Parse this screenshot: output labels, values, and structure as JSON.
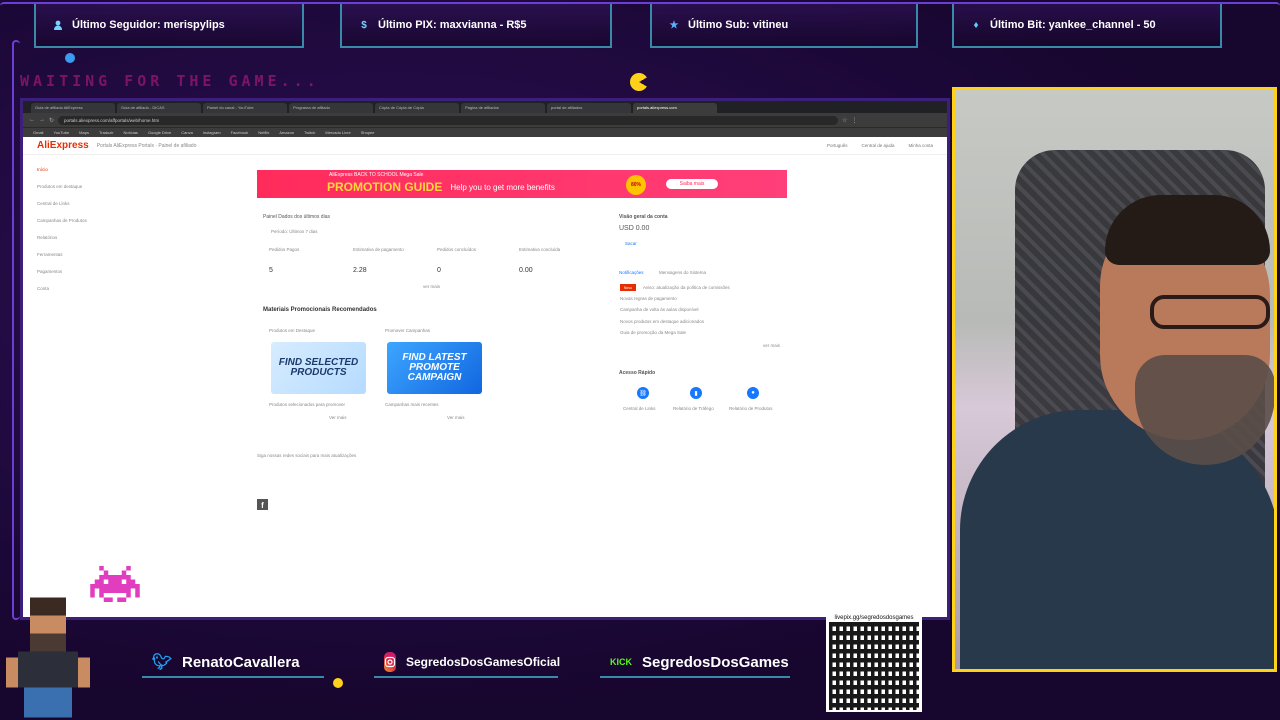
{
  "overlay": {
    "tickers": [
      {
        "icon": "user-icon",
        "text": "Último Seguidor: merispylips"
      },
      {
        "icon": "dollar-icon",
        "text": "Último PIX: maxvianna - R$5"
      },
      {
        "icon": "star-icon",
        "text": "Último Sub: vitineu"
      },
      {
        "icon": "diamond-icon",
        "text": "Último Bit: yankee_channel - 50"
      }
    ],
    "waiting_text": "WAITING FOR THE GAME...",
    "socials": [
      {
        "icon": "twitter-icon",
        "text": "RenatoCavallera",
        "color": "#1da1f2"
      },
      {
        "icon": "instagram-icon",
        "text": "SegredosDosGamesOficial",
        "color": "#e1306c"
      },
      {
        "icon": "kick-icon",
        "text": "SegredosDosGames",
        "color": "#53fc18",
        "icon_text": "KICK"
      }
    ],
    "qr_url": "livepix.gg/segredosdosgames",
    "accent": "#6b3fd6",
    "ticker_border": "#3a89a8",
    "webcam_border": "#ffd21a"
  },
  "browser": {
    "tabs": [
      "Guia de afiliado AliExpress",
      "Guia de afiliado - DICAS",
      "Painel do canal - YouTube",
      "Programa de afiliado",
      "Cópia de Cópia de Cópia",
      "Página de afiliados",
      "portal de afiliados",
      "portals.aliexpress.com"
    ],
    "url": "portals.aliexpress.com/affportals/web/home.htm",
    "bookmarks": [
      "Gmail",
      "YouTube",
      "Maps",
      "Traduzir",
      "Notícias",
      "Google Drive",
      "Canva",
      "Instagram",
      "Facebook",
      "Netflix",
      "Amazon",
      "Twitch",
      "Mercado Livre",
      "Shopee"
    ],
    "page": {
      "logo": "AliExpress",
      "logo_sub": "Portals  AliExpress Portals · Painel de afiliado",
      "header_right": [
        "Português",
        "Central de ajuda",
        "Minha conta"
      ],
      "sidebar": [
        "Início",
        "Produtos em destaque",
        "Central de Links",
        "Campanhas de Produtos",
        "Relatórios",
        "Ferramentas",
        "Pagamentos",
        "Conta"
      ],
      "promo": {
        "brand": "AliExpress  BACK TO SCHOOL  Mega Sale",
        "title": "PROMOTION GUIDE",
        "desc": "Help you to get more benefits",
        "badge": "80%",
        "button": "Saiba mais"
      },
      "panel": {
        "title": "Painel  Dados dos últimos dias",
        "filter": "Período: Últimos 7 dias",
        "metrics": [
          {
            "label": "Pedidos Pagos",
            "value": "5"
          },
          {
            "label": "Estimativa de pagamento",
            "value": "2.28"
          },
          {
            "label": "Pedidos concluídos",
            "value": "0"
          },
          {
            "label": "Estimativa concluída",
            "value": "0.00"
          }
        ],
        "more": "ver mais"
      },
      "balance": {
        "title": "Visão geral da conta",
        "value": "USD 0.00",
        "link": "Sacar"
      },
      "notices": {
        "tabs": [
          "Notificações",
          "Mensagens do Sistema"
        ],
        "tag": "Novo",
        "items": [
          "Aviso: atualização da política de comissões",
          "Novas regras de pagamento",
          "Campanha de volta às aulas disponível",
          "Novos produtos em destaque adicionados",
          "Guia de promoção da Mega Sale"
        ],
        "more": "ver mais"
      },
      "promotions": {
        "title": "Materiais Promocionais Recomendados",
        "cards": [
          {
            "label": "Produtos em Destaque",
            "image_text": "FIND SELECTED PRODUCTS",
            "caption": "Produtos selecionados para promover",
            "action": "Ver mais"
          },
          {
            "label": "Promover Campanhas",
            "image_text": "FIND LATEST PROMOTE CAMPAIGN",
            "caption": "Campanhas mais recentes",
            "action": "Ver mais"
          }
        ]
      },
      "quick_access": {
        "title": "Acesso Rápido",
        "items": [
          {
            "icon": "link-icon",
            "label": "Central de Links"
          },
          {
            "icon": "bar-chart-icon",
            "label": "Relatório de Tráfego"
          },
          {
            "icon": "circle-icon",
            "label": "Relatório de Produtos"
          }
        ]
      },
      "social_footer": "Siga nossas redes sociais para mais atualizações"
    }
  }
}
